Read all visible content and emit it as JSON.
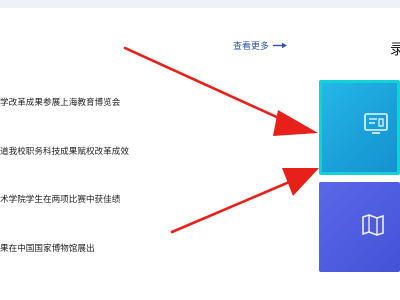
{
  "header": {
    "more_label": "查看更多"
  },
  "news": {
    "items": [
      {
        "text": "学改革成果参展上海教育博览会"
      },
      {
        "text": "道我校职务科技成果赋权改革成效"
      },
      {
        "text": "术学院学生在两项比赛中获佳绩"
      },
      {
        "text": "果在中国国家博物馆展出"
      }
    ]
  },
  "right_panel": {
    "title": "录"
  },
  "tiles": [
    {
      "icon": "dashboard-icon",
      "color": "#1a9fd8",
      "highlighted": true
    },
    {
      "icon": "map-icon",
      "color": "#4d5bdf",
      "highlighted": false
    }
  ],
  "annotations": {
    "arrow_color": "#e8201a"
  }
}
